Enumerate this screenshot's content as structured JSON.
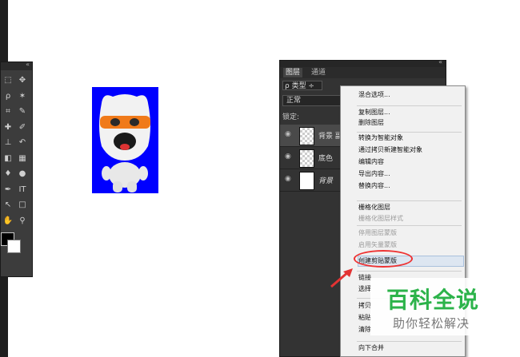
{
  "tools_panel": {
    "collapse_glyph": "«",
    "close_glyph": "×",
    "tools": [
      {
        "name": "marquee-tool-icon",
        "glyph": "⬚"
      },
      {
        "name": "move-tool-icon",
        "glyph": "✥"
      },
      {
        "name": "lasso-tool-icon",
        "glyph": "ρ"
      },
      {
        "name": "magic-wand-tool-icon",
        "glyph": "✶"
      },
      {
        "name": "crop-tool-icon",
        "glyph": "⌗"
      },
      {
        "name": "eyedropper-tool-icon",
        "glyph": "✎"
      },
      {
        "name": "healing-tool-icon",
        "glyph": "✚"
      },
      {
        "name": "brush-tool-icon",
        "glyph": "✐"
      },
      {
        "name": "stamp-tool-icon",
        "glyph": "⊥"
      },
      {
        "name": "history-brush-tool-icon",
        "glyph": "↶"
      },
      {
        "name": "eraser-tool-icon",
        "glyph": "◧"
      },
      {
        "name": "gradient-tool-icon",
        "glyph": "▦"
      },
      {
        "name": "blur-tool-icon",
        "glyph": "♦"
      },
      {
        "name": "dodge-tool-icon",
        "glyph": "●"
      },
      {
        "name": "pen-tool-icon",
        "glyph": "✒"
      },
      {
        "name": "type-tool-icon",
        "glyph": "IT"
      },
      {
        "name": "path-selection-tool-icon",
        "glyph": "↖"
      },
      {
        "name": "shape-tool-icon",
        "glyph": "□"
      },
      {
        "name": "hand-tool-icon",
        "glyph": "✋"
      },
      {
        "name": "zoom-tool-icon",
        "glyph": "⚲"
      }
    ]
  },
  "layers_panel": {
    "collapse_glyph": "«",
    "tabs": [
      "图层",
      "通道"
    ],
    "filter_label": "ρ 类型 ÷",
    "blend_mode": "正常",
    "lock_label": "锁定:",
    "layers": [
      {
        "name": "背景 副本",
        "thumb": "check"
      },
      {
        "name": "底色",
        "thumb": "check"
      },
      {
        "name": "背景",
        "thumb": "white"
      }
    ]
  },
  "context_menu": {
    "items": [
      {
        "label": "混合选项...",
        "disabled": false
      },
      {
        "label": "复制图层...",
        "disabled": false
      },
      {
        "label": "删除图层",
        "disabled": false
      },
      {
        "label": "转换为智能对象",
        "disabled": false
      },
      {
        "label": "通过拷贝新建智能对象",
        "disabled": false
      },
      {
        "label": "编辑内容",
        "disabled": false
      },
      {
        "label": "导出内容...",
        "disabled": false
      },
      {
        "label": "替换内容...",
        "disabled": false
      },
      {
        "label": "栅格化图层",
        "disabled": false
      },
      {
        "label": "栅格化图层样式",
        "disabled": true
      },
      {
        "label": "停用图层蒙版",
        "disabled": true
      },
      {
        "label": "启用矢量蒙版",
        "disabled": true
      },
      {
        "label": "创建剪贴蒙版",
        "disabled": false,
        "highlighted": true
      },
      {
        "label": "链接",
        "disabled": false
      },
      {
        "label": "选择",
        "disabled": false
      },
      {
        "label": "拷贝",
        "disabled": false
      },
      {
        "label": "粘贴",
        "disabled": false
      },
      {
        "label": "清除",
        "disabled": false
      },
      {
        "label": "向下合并",
        "disabled": false
      }
    ]
  },
  "watermark": {
    "title": "百科全说",
    "subtitle": "助你轻松解决"
  },
  "colors": {
    "canvas_bg": "#0000ff",
    "annotation": "#e33333",
    "watermark_green": "#2cb34a"
  }
}
